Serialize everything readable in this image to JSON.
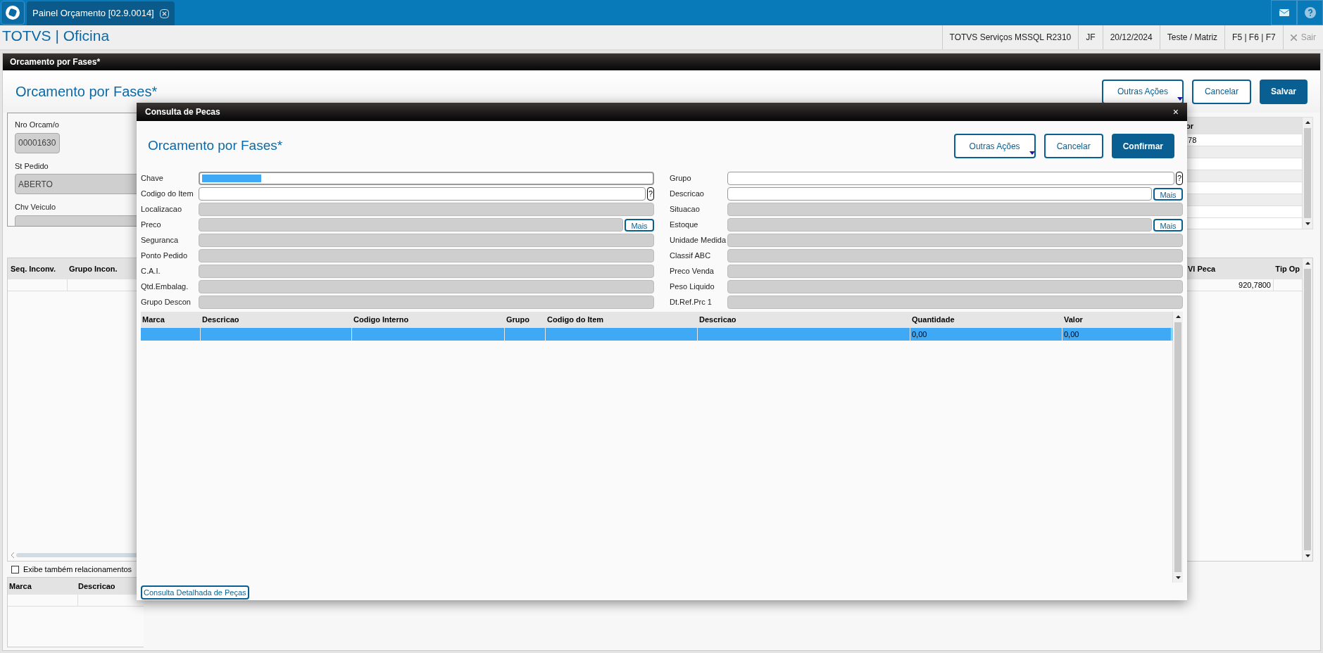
{
  "tab": {
    "label": "Painel Orçamento [02.9.0014]",
    "selected": true
  },
  "app_title": "TOTVS | Oficina",
  "header_info": [
    "TOTVS Serviços MSSQL R2310",
    "JF",
    "20/12/2024",
    "Teste / Matriz",
    "F5 | F6 | F7"
  ],
  "exit_button": {
    "label": "Sair",
    "disabled": true
  },
  "page": {
    "title_bar": "Orcamento por Fases*",
    "heading": "Orcamento por Fases*",
    "buttons": [
      {
        "label": "Outras Ações",
        "kind": "menu"
      },
      {
        "label": "Cancelar",
        "kind": "secondary"
      },
      {
        "label": "Salvar",
        "kind": "primary"
      }
    ],
    "fields": [
      {
        "label": "Nro Orcam/o",
        "value": "00001630"
      },
      {
        "label": "St Pedido",
        "value": "ABERTO"
      },
      {
        "label": "Chv Veiculo"
      }
    ],
    "summary_table": {
      "column_1": "or",
      "rows": [
        ",78"
      ]
    },
    "inconsistency_table": {
      "columns": [
        "Seq. Inconv.",
        "Grupo Incon."
      ],
      "right_columns": [
        "Vl Peca",
        "Tip Op"
      ],
      "vl_peca": "920,7800"
    },
    "related_checkbox": {
      "label": "Exibe também relacionamentos",
      "checked": false
    },
    "parts_table": {
      "columns": [
        "Marca",
        "Descricao"
      ]
    }
  },
  "dialog": {
    "title": "Consulta de Pecas",
    "close": "×",
    "heading": "Orcamento por Fases*",
    "buttons": [
      {
        "label": "Outras Ações",
        "kind": "menu"
      },
      {
        "label": "Cancelar",
        "kind": "secondary"
      },
      {
        "label": "Confirmar",
        "kind": "primary"
      }
    ],
    "fields_left": [
      {
        "label": "Chave",
        "kind": "focused"
      },
      {
        "label": "Codigo do Item",
        "kind": "text",
        "button": "?"
      },
      {
        "label": "Localizacao",
        "kind": "readonly"
      },
      {
        "label": "Preco",
        "kind": "readonly",
        "button": "Mais"
      },
      {
        "label": "Seguranca",
        "kind": "readonly"
      },
      {
        "label": "Ponto Pedido",
        "kind": "readonly"
      },
      {
        "label": "C.A.I.",
        "kind": "readonly"
      },
      {
        "label": "Qtd.Embalag.",
        "kind": "readonly"
      },
      {
        "label": "Grupo Descon",
        "kind": "readonly"
      }
    ],
    "fields_right": [
      {
        "label": "Grupo",
        "kind": "text",
        "button": "?"
      },
      {
        "label": "Descricao",
        "kind": "text",
        "button": "Mais"
      },
      {
        "label": "Situacao",
        "kind": "readonly"
      },
      {
        "label": "Estoque",
        "kind": "readonly",
        "button": "Mais"
      },
      {
        "label": "Unidade Medida",
        "kind": "readonly"
      },
      {
        "label": "Classif ABC",
        "kind": "readonly"
      },
      {
        "label": "Preco Venda",
        "kind": "readonly"
      },
      {
        "label": "Peso Liquido",
        "kind": "readonly"
      },
      {
        "label": "Dt.Ref.Prc 1",
        "kind": "readonly"
      }
    ],
    "grid": {
      "columns": [
        "Marca",
        "Descricao",
        "Codigo Interno",
        "Grupo",
        "Codigo do Item",
        "Descricao",
        "Quantidade",
        "Valor"
      ],
      "rows": [
        {
          "selected": true,
          "cells": [
            null,
            null,
            null,
            null,
            null,
            null,
            "0,00",
            "0,00"
          ]
        }
      ]
    },
    "detail_button": "Consulta Detalhada de Peças"
  }
}
